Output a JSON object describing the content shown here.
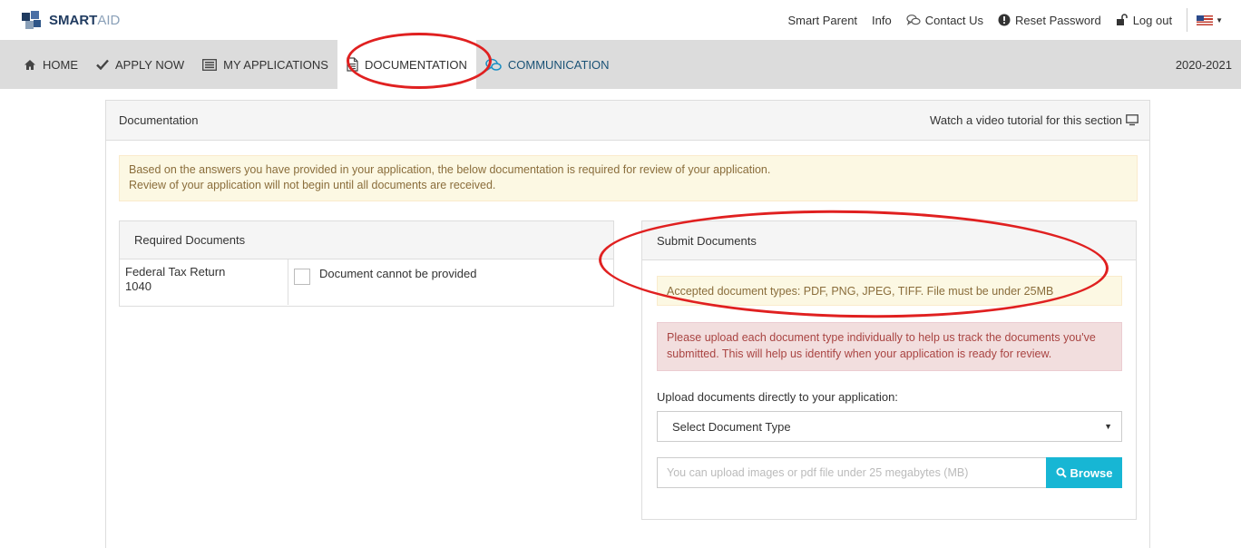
{
  "brand": {
    "bold": "SMART",
    "light": "AID"
  },
  "top_links": {
    "smart_parent": "Smart Parent",
    "info": "Info",
    "contact": "Contact Us",
    "reset": "Reset Password",
    "logout": "Log out"
  },
  "nav": {
    "home": "HOME",
    "apply": "APPLY NOW",
    "applications": "MY APPLICATIONS",
    "documentation": "DOCUMENTATION",
    "communication": "COMMUNICATION",
    "year": "2020-2021"
  },
  "panel": {
    "title": "Documentation",
    "tutorial": "Watch a video tutorial for this section",
    "notice_line1": "Based on the answers you have provided in your application, the below documentation is required for review of your application.",
    "notice_line2": "Review of your application will not begin until all documents are received."
  },
  "required": {
    "title": "Required Documents",
    "rows": [
      {
        "doc_name": "Federal Tax Return",
        "doc_form": "1040",
        "checkbox_label": "Document cannot be provided"
      }
    ]
  },
  "submit": {
    "title": "Submit Documents",
    "accepted": "Accepted document types: PDF, PNG, JPEG, TIFF. File must be under 25MB",
    "warning": "Please upload each document type individually to help us track the documents you've submitted. This will help us identify when your application is ready for review.",
    "upload_label": "Upload documents directly to your application:",
    "select_value": "Select Document Type",
    "file_placeholder": "You can upload images or pdf file under 25 megabytes (MB)",
    "browse_label": "Browse"
  },
  "colors": {
    "accent": "#17b6d4",
    "annotation": "#e02020",
    "nav_bg": "#dcdcdc"
  }
}
